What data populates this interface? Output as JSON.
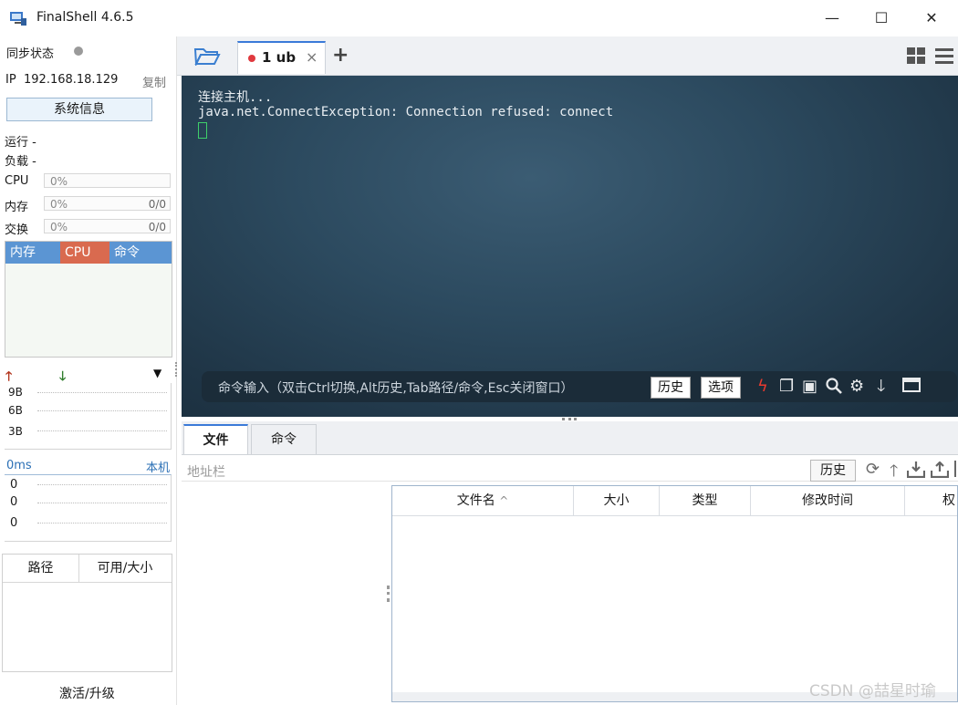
{
  "window": {
    "title": "FinalShell 4.6.5",
    "controls": {
      "minimize": "—",
      "maximize": "☐",
      "close": "✕"
    }
  },
  "sidebar": {
    "sync_label": "同步状态",
    "ip_label": "IP",
    "ip_value": "192.168.18.129",
    "copy_label": "复制",
    "sysinfo_button": "系统信息",
    "run_label": "运行 -",
    "load_label": "负载 -",
    "cpu_label": "CPU",
    "cpu_value": "0%",
    "mem_label": "内存",
    "mem_value": "0%",
    "mem_ratio": "0/0",
    "swap_label": "交换",
    "swap_value": "0%",
    "swap_ratio": "0/0",
    "proc_headers": [
      "内存",
      "CPU",
      "命令"
    ],
    "net_ticks": [
      "9B",
      "6B",
      "3B"
    ],
    "latency_label": "0ms",
    "local_label": "本机",
    "latency_values": [
      "0",
      "0",
      "0"
    ],
    "disk_headers": [
      "路径",
      "可用/大小"
    ],
    "activate_label": "激活/升级",
    "colors": {
      "proc_mem": "#5b95d3",
      "proc_cpu": "#d96a4f",
      "proc_cmd": "#5b95d3",
      "up_arrow": "#b3361e",
      "down_arrow": "#2f7d2c"
    }
  },
  "tabs": {
    "session_label": "1 ub",
    "session_dot_color": "#e0393e",
    "close_icon": "×",
    "add_icon": "+"
  },
  "terminal": {
    "line1": "连接主机...",
    "line2": "java.net.ConnectException: Connection refused: connect",
    "cursor_color": "#3ecf6a",
    "cmd_placeholder": "命令输入（双击Ctrl切换,Alt历史,Tab路径/命令,Esc关闭窗口）",
    "history_button": "历史",
    "options_button": "选项"
  },
  "files": {
    "tabs": [
      "文件",
      "命令"
    ],
    "address_placeholder": "地址栏",
    "history_button": "历史",
    "columns": [
      "文件名",
      "大小",
      "类型",
      "修改时间",
      "权"
    ],
    "sort_indicator": "^"
  },
  "watermark": "CSDN @喆星时瑜"
}
